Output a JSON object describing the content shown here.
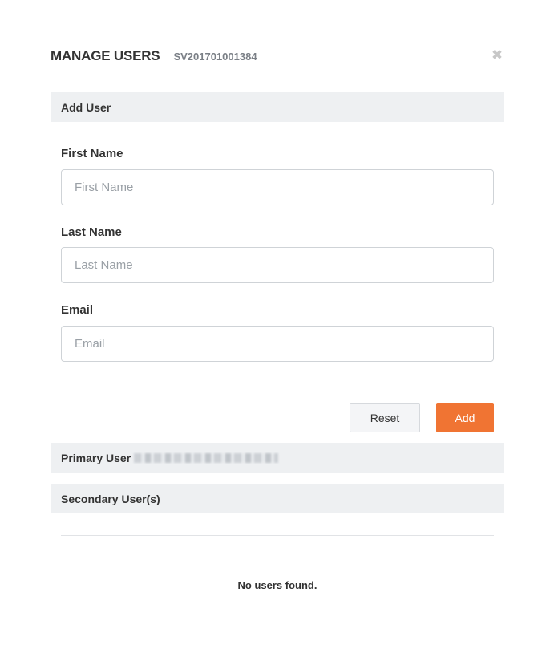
{
  "header": {
    "title": "MANAGE USERS",
    "subtitle": "SV201701001384",
    "close_icon": "close-icon",
    "close_glyph": "✖"
  },
  "add_user": {
    "section_title": "Add User",
    "first_name": {
      "label": "First Name",
      "placeholder": "First Name",
      "value": ""
    },
    "last_name": {
      "label": "Last Name",
      "placeholder": "Last Name",
      "value": ""
    },
    "email": {
      "label": "Email",
      "placeholder": "Email",
      "value": ""
    },
    "reset_label": "Reset",
    "add_label": "Add"
  },
  "primary_user": {
    "label": "Primary User"
  },
  "secondary_users": {
    "label": "Secondary User(s)",
    "empty_message": "No users found."
  },
  "colors": {
    "accent": "#f07433",
    "section_bg": "#eef0f2",
    "text": "#333333",
    "muted": "#7a7f86"
  }
}
